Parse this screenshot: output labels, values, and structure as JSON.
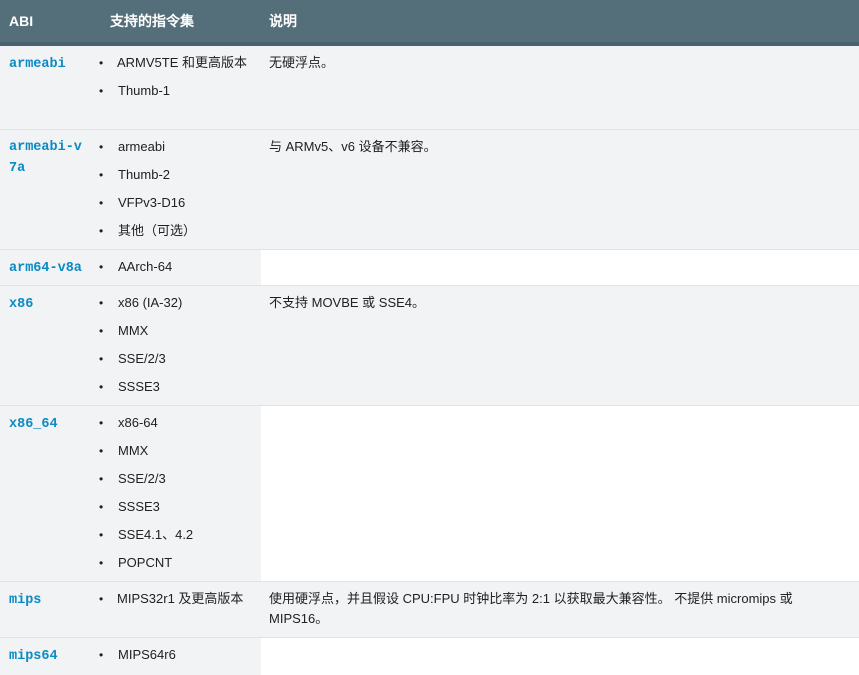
{
  "header": {
    "col_abi": "ABI",
    "col_isa": "支持的指令集",
    "col_desc": "说明"
  },
  "rows": [
    {
      "abi": "armeabi",
      "isa": [
        "ARMV5TE 和更高版本",
        "Thumb-1"
      ],
      "desc": "无硬浮点。"
    },
    {
      "abi": "armeabi-v7a",
      "isa": [
        "armeabi",
        "Thumb-2",
        "VFPv3-D16",
        "其他（可选）"
      ],
      "desc": "与 ARMv5、v6 设备不兼容。"
    },
    {
      "abi": "arm64-v8a",
      "isa": [
        "AArch-64"
      ],
      "desc": ""
    },
    {
      "abi": "x86",
      "isa": [
        "x86 (IA-32)",
        "MMX",
        "SSE/2/3",
        "SSSE3"
      ],
      "desc": "不支持 MOVBE 或 SSE4。"
    },
    {
      "abi": "x86_64",
      "isa": [
        "x86-64",
        "MMX",
        "SSE/2/3",
        "SSSE3",
        "SSE4.1、4.2",
        "POPCNT"
      ],
      "desc": ""
    },
    {
      "abi": "mips",
      "isa": [
        "MIPS32r1 及更高版本"
      ],
      "desc": "使用硬浮点，并且假设 CPU:FPU 时钟比率为 2:1 以获取最大兼容性。 不提供 micromips 或 MIPS16。"
    },
    {
      "abi": "mips64",
      "isa": [
        "MIPS64r6"
      ],
      "desc": ""
    }
  ]
}
